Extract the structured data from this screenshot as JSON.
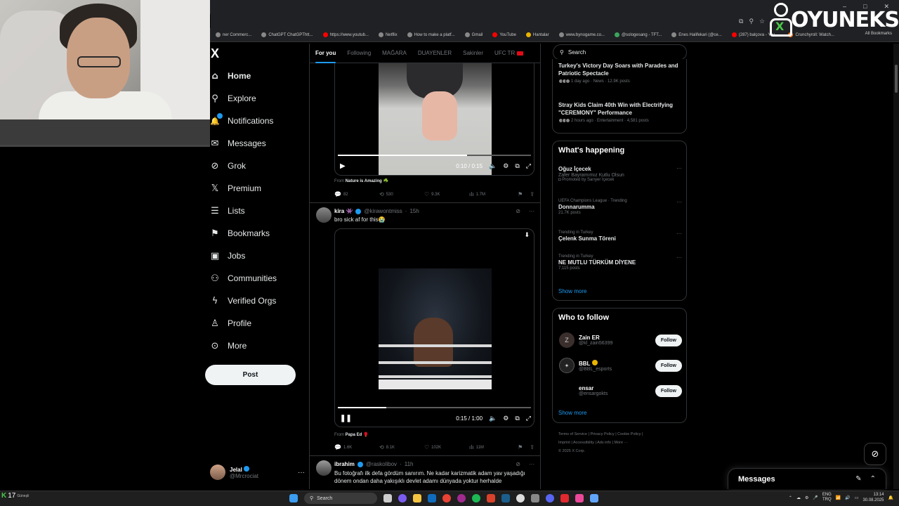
{
  "brand": {
    "text": "OYUNEKS",
    "mascot_mark": "X"
  },
  "window_controls": [
    "–",
    "□",
    "✕"
  ],
  "bookmarks": [
    "ner Commerc...",
    "ChatGPT ChatGPThtt...",
    "https://www.youtub...",
    "Netflix",
    "How to make a platf...",
    "Gmail",
    "YouTube",
    "Hantalar",
    "www.bynogame.co...",
    "@sologesang - TFT...",
    "Enes Halifekari (@ce...",
    "(287) balçova - You...",
    "Crunchyroll: Watch..."
  ],
  "all_bookmarks": "All Bookmarks",
  "nav": {
    "logo": "X",
    "items": [
      {
        "label": "Home",
        "icon": "home-icon",
        "glyph": "⌂"
      },
      {
        "label": "Explore",
        "icon": "search-icon",
        "glyph": "⚲"
      },
      {
        "label": "Notifications",
        "icon": "bell-icon",
        "glyph": "🔔"
      },
      {
        "label": "Messages",
        "icon": "envelope-icon",
        "glyph": "✉"
      },
      {
        "label": "Grok",
        "icon": "grok-icon",
        "glyph": "⊘"
      },
      {
        "label": "Premium",
        "icon": "x-premium-icon",
        "glyph": "𝕏"
      },
      {
        "label": "Lists",
        "icon": "list-icon",
        "glyph": "☰"
      },
      {
        "label": "Bookmarks",
        "icon": "bookmark-icon",
        "glyph": "⚑"
      },
      {
        "label": "Jobs",
        "icon": "briefcase-icon",
        "glyph": "▣"
      },
      {
        "label": "Communities",
        "icon": "people-icon",
        "glyph": "⚇"
      },
      {
        "label": "Verified Orgs",
        "icon": "lightning-icon",
        "glyph": "ϟ"
      },
      {
        "label": "Profile",
        "icon": "person-icon",
        "glyph": "♙"
      },
      {
        "label": "More",
        "icon": "more-circle-icon",
        "glyph": "⊙"
      }
    ],
    "post_label": "Post",
    "account": {
      "name": "Jelal",
      "handle": "@Mrcrociat"
    }
  },
  "tabs": [
    "For you",
    "Following",
    "MAĞARA",
    "DUAYENLER",
    "Sakinler",
    "UFC TR"
  ],
  "tweet1": {
    "time": "0:10 / 0:15",
    "progress": 0.67,
    "from_prefix": "From",
    "from": "Nature is Amazing ☘️",
    "replies": "82",
    "reposts": "530",
    "likes": "9.3K",
    "views": "1.7M"
  },
  "tweet2": {
    "name": "kira 👾",
    "handle": "@kirawontmiss",
    "age": "15h",
    "text": "bro sick af for this😭",
    "time": "0:15 / 1:00",
    "progress": 0.25,
    "from_prefix": "From",
    "from": "Papa Ed 🥊",
    "replies": "1.6K",
    "reposts": "8.1K",
    "likes": "102K",
    "views": "11M"
  },
  "tweet3": {
    "name": "ibrahim",
    "handle": "@raskolibov",
    "age": "11h",
    "text": "Bu fotoğrafı ilk defa gördüm sanırım. Ne kadar karizmatik adam yav yaşadığı dönem ondan daha yakışıklı devlet adamı dünyada yoktur herhalde"
  },
  "search_placeholder": "Search",
  "top_trends": [
    {
      "title": "Turkey's Victory Day Soars with Parades and Patriotic Spectacle",
      "sub": "1 day ago · News · 12.9K posts"
    },
    {
      "title": "Stray Kids Claim 40th Win with Electrifying \"CEREMONY\" Performance",
      "sub": "2 hours ago · Entertainment · 4,581 posts"
    }
  ],
  "whats_happening": {
    "title": "What's happening",
    "trends": [
      {
        "meta": "",
        "title": "Oğuz İçecek",
        "sub": "Zafer Bayramımız Kutlu Olsun",
        "sub2": "Promoted by Sarıyer İçecek"
      },
      {
        "meta": "UEFA Champions League · Trending",
        "title": "Donnarumma",
        "sub": "21.7K posts",
        "sub2": ""
      },
      {
        "meta": "Trending in Turkey",
        "title": "Çelenk Sunma Töreni",
        "sub": "",
        "sub2": ""
      },
      {
        "meta": "Trending in Turkey",
        "title": "NE MUTLU TÜRKÜM DİYENE",
        "sub": "7,115 posts",
        "sub2": ""
      }
    ],
    "show_more": "Show more"
  },
  "who_to_follow": {
    "title": "Who to follow",
    "users": [
      {
        "initial": "Z",
        "name": "Zain ER",
        "handle": "@kl_zain56399",
        "button": "Follow"
      },
      {
        "initial": "",
        "name": "BBL",
        "handle": "@BBL_esports",
        "button": "Follow"
      },
      {
        "initial": "",
        "name": "ensar",
        "handle": "@ensargokts",
        "button": "Follow"
      }
    ],
    "show_more": "Show more"
  },
  "footer": {
    "line1": "Terms of Service  |  Privacy Policy  |  Cookie Policy  |",
    "line2": "Imprint  |  Accessibility  |  Ads info  |  More ···",
    "line3": "© 2025 X Corp."
  },
  "messages_drawer": "Messages",
  "taskbar": {
    "temp": "17",
    "weather_label": "Güneşli",
    "search": "Search",
    "lang": "ENG",
    "region": "TRQ",
    "time": "13:14",
    "date": "30.08.2025"
  },
  "colors": {
    "accent": "#1d9bf0",
    "bg": "#000000",
    "border": "#2f3336",
    "muted": "#71767b"
  }
}
